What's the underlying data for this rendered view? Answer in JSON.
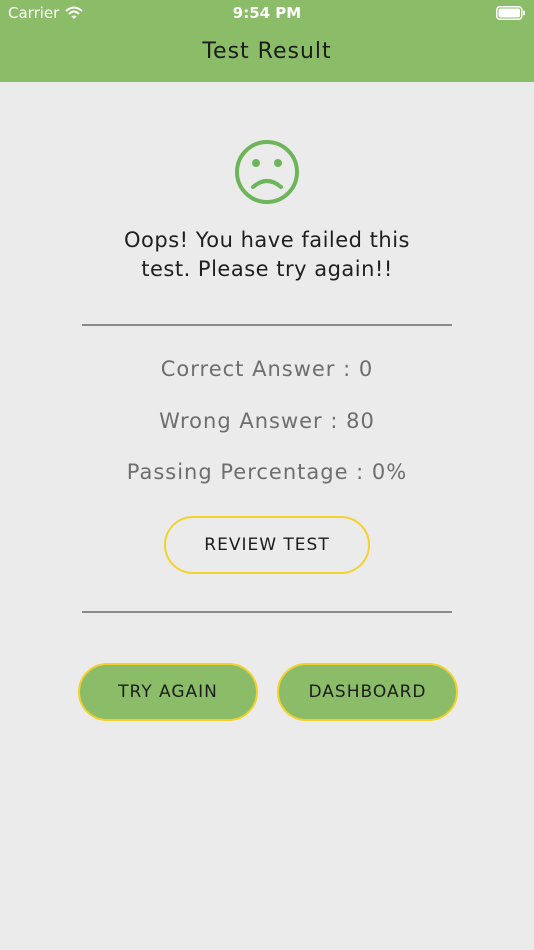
{
  "status_bar": {
    "carrier": "Carrier",
    "time": "9:54 PM"
  },
  "nav": {
    "title": "Test Result"
  },
  "result": {
    "message_line1": "Oops! You have failed this",
    "message_line2": "test. Please try again!!",
    "correct": "Correct Answer : 0",
    "wrong": "Wrong Answer : 80",
    "passing": "Passing Percentage : 0%"
  },
  "buttons": {
    "review": "REVIEW TEST",
    "try_again": "TRY AGAIN",
    "dashboard": "DASHBOARD"
  },
  "colors": {
    "header_green": "#8bbd69",
    "icon_green": "#6db55a",
    "button_border_yellow": "#f3d12f",
    "background": "#ebebeb"
  },
  "icons": {
    "result_icon": "sad-face-icon",
    "wifi": "wifi-icon",
    "battery": "battery-icon"
  }
}
